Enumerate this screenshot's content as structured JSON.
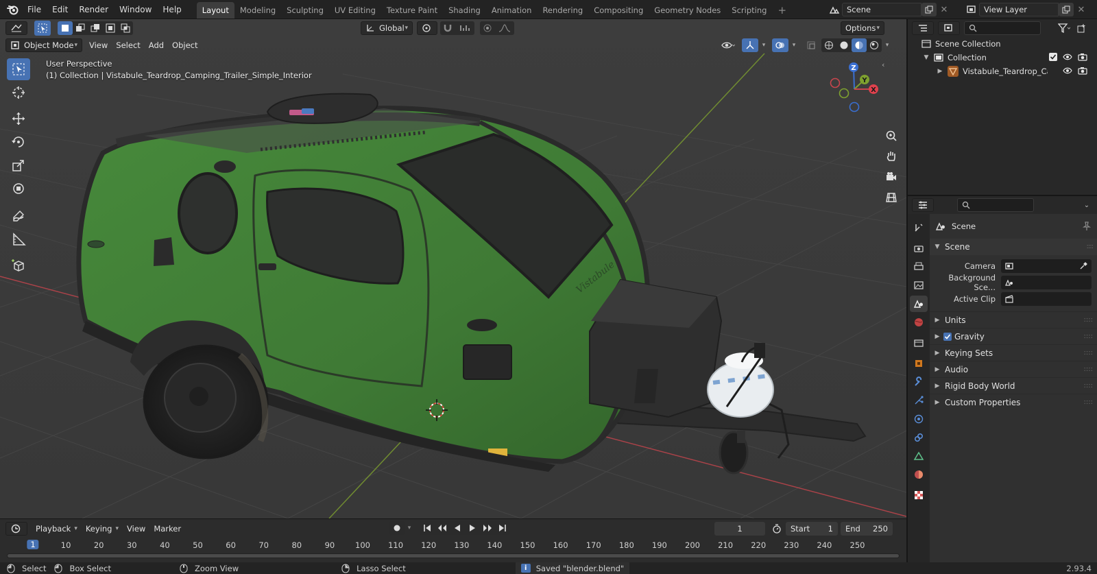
{
  "topbar": {
    "menus": [
      "File",
      "Edit",
      "Render",
      "Window",
      "Help"
    ],
    "workspaces": [
      "Layout",
      "Modeling",
      "Sculpting",
      "UV Editing",
      "Texture Paint",
      "Shading",
      "Animation",
      "Rendering",
      "Compositing",
      "Geometry Nodes",
      "Scripting"
    ],
    "active_workspace": "Layout",
    "add_tab": "+",
    "scene": "Scene",
    "view_layer": "View Layer"
  },
  "viewport": {
    "orientation": "Global",
    "options": "Options",
    "mode": "Object Mode",
    "menus": [
      "View",
      "Select",
      "Add",
      "Object"
    ],
    "perspective_label": "User Perspective",
    "collection_label": "(1) Collection | Vistabule_Teardrop_Camping_Trailer_Simple_Interior",
    "gizmo_axes": {
      "z": "Z",
      "y": "Y",
      "x": "X"
    },
    "trailer_script": "Vistabule",
    "colors": {
      "background": "#3b3b3b",
      "trailer_green": "#3f7a35",
      "x_axis": "#c8454d",
      "y_axis": "#7ea12f",
      "accent": "#4772b3"
    }
  },
  "timeline": {
    "menus": [
      "Playback",
      "Keying",
      "View",
      "Marker"
    ],
    "current_frame": "1",
    "start_label": "Start",
    "start_value": "1",
    "end_label": "End",
    "end_value": "250",
    "ruler": [
      "1",
      "10",
      "20",
      "30",
      "40",
      "50",
      "60",
      "70",
      "80",
      "90",
      "100",
      "110",
      "120",
      "130",
      "140",
      "150",
      "160",
      "170",
      "180",
      "190",
      "200",
      "210",
      "220",
      "230",
      "240",
      "250"
    ]
  },
  "statusbar": {
    "hints": [
      "Select",
      "Box Select",
      "Zoom View",
      "Lasso Select"
    ],
    "message": "Saved \"blender.blend\"",
    "version": "2.93.4"
  },
  "outliner": {
    "scene_collection": "Scene Collection",
    "collection": "Collection",
    "object": "Vistabule_Teardrop_Camp"
  },
  "properties": {
    "context": "Scene",
    "panel": "Scene",
    "camera_label": "Camera",
    "background_label": "Background Sce...",
    "active_clip_label": "Active Clip",
    "subpanels": [
      "Units",
      "Gravity",
      "Keying Sets",
      "Audio",
      "Rigid Body World",
      "Custom Properties"
    ],
    "gravity_checked": true
  }
}
